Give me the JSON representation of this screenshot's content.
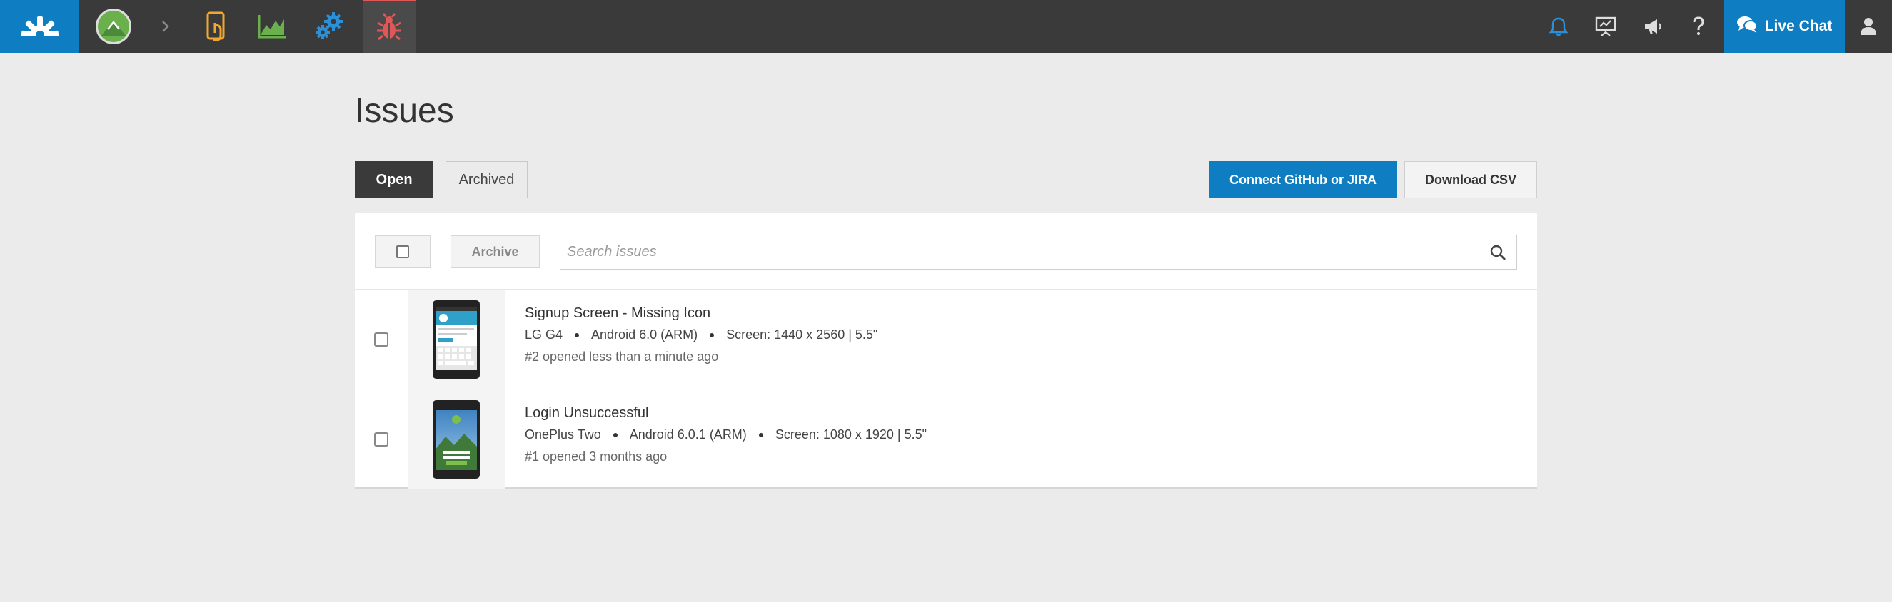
{
  "nav": {
    "live_chat_label": "Live Chat",
    "icons": [
      "logo-gear-icon",
      "app-avatar-icon",
      "chevron-right-icon",
      "touch-phone-icon",
      "chart-icon",
      "gears-icon",
      "bug-icon",
      "bell-icon",
      "presentation-icon",
      "megaphone-icon",
      "help-icon",
      "chat-icon",
      "user-icon"
    ],
    "accent_color": "#0f7dc2",
    "active_accent_color": "#e05757"
  },
  "page": {
    "title": "Issues"
  },
  "tabs": {
    "open_label": "Open",
    "archived_label": "Archived"
  },
  "actions": {
    "connect_label": "Connect GitHub or JIRA",
    "download_csv_label": "Download CSV"
  },
  "toolbar": {
    "archive_label": "Archive",
    "search_placeholder": "Search issues"
  },
  "issues": [
    {
      "title": "Signup Screen - Missing Icon",
      "device": "LG G4",
      "os": "Android 6.0 (ARM)",
      "screen": "Screen: 1440 x 2560 | 5.5\"",
      "status": "#2 opened less than a minute ago"
    },
    {
      "title": "Login Unsuccessful",
      "device": "OnePlus Two",
      "os": "Android 6.0.1 (ARM)",
      "screen": "Screen: 1080 x 1920 | 5.5\"",
      "status": "#1 opened 3 months ago"
    }
  ]
}
